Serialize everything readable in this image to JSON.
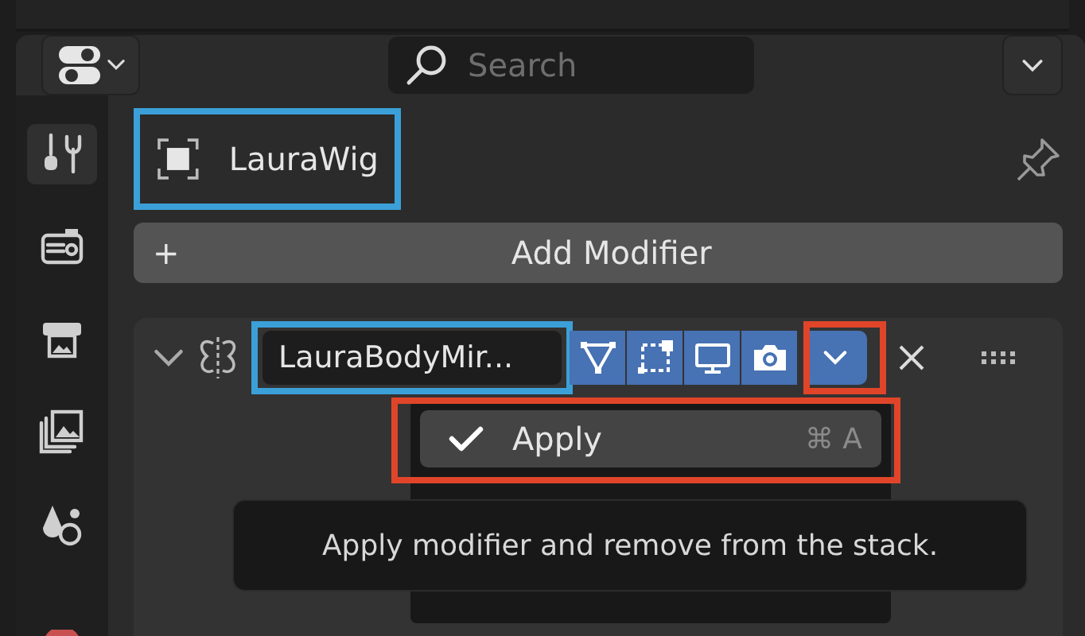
{
  "header": {
    "search": {
      "placeholder": "Search"
    }
  },
  "sidebar": {
    "items": [
      {
        "kind": "tool",
        "selected": true
      },
      {
        "kind": "render",
        "selected": false
      },
      {
        "kind": "output",
        "selected": false
      },
      {
        "kind": "view-layer",
        "selected": false
      },
      {
        "kind": "scene",
        "selected": false
      },
      {
        "kind": "world",
        "selected": false
      }
    ]
  },
  "object": {
    "name": "LauraWig"
  },
  "add_modifier": {
    "label": "Add Modifier",
    "icon": "+"
  },
  "modifier": {
    "name": "LauraBodyMir...",
    "expanded": true,
    "toggles": [
      {
        "kind": "edit-cage",
        "on": true
      },
      {
        "kind": "edit-mode",
        "on": true
      },
      {
        "kind": "viewport",
        "on": true
      },
      {
        "kind": "render",
        "on": true
      }
    ]
  },
  "menu": {
    "items": [
      {
        "label": "Apply",
        "shortcut": "⌘ A",
        "highlighted": true
      }
    ]
  },
  "annotations": [
    {
      "kind": "object-name",
      "color": "#3ba0d8"
    },
    {
      "kind": "modifier-name",
      "color": "#3ba0d8"
    },
    {
      "kind": "menu-button",
      "color": "#e0452a"
    },
    {
      "kind": "menu-item",
      "color": "#e0452a"
    }
  ],
  "tooltip": {
    "text": "Apply modifier and remove from the stack."
  }
}
